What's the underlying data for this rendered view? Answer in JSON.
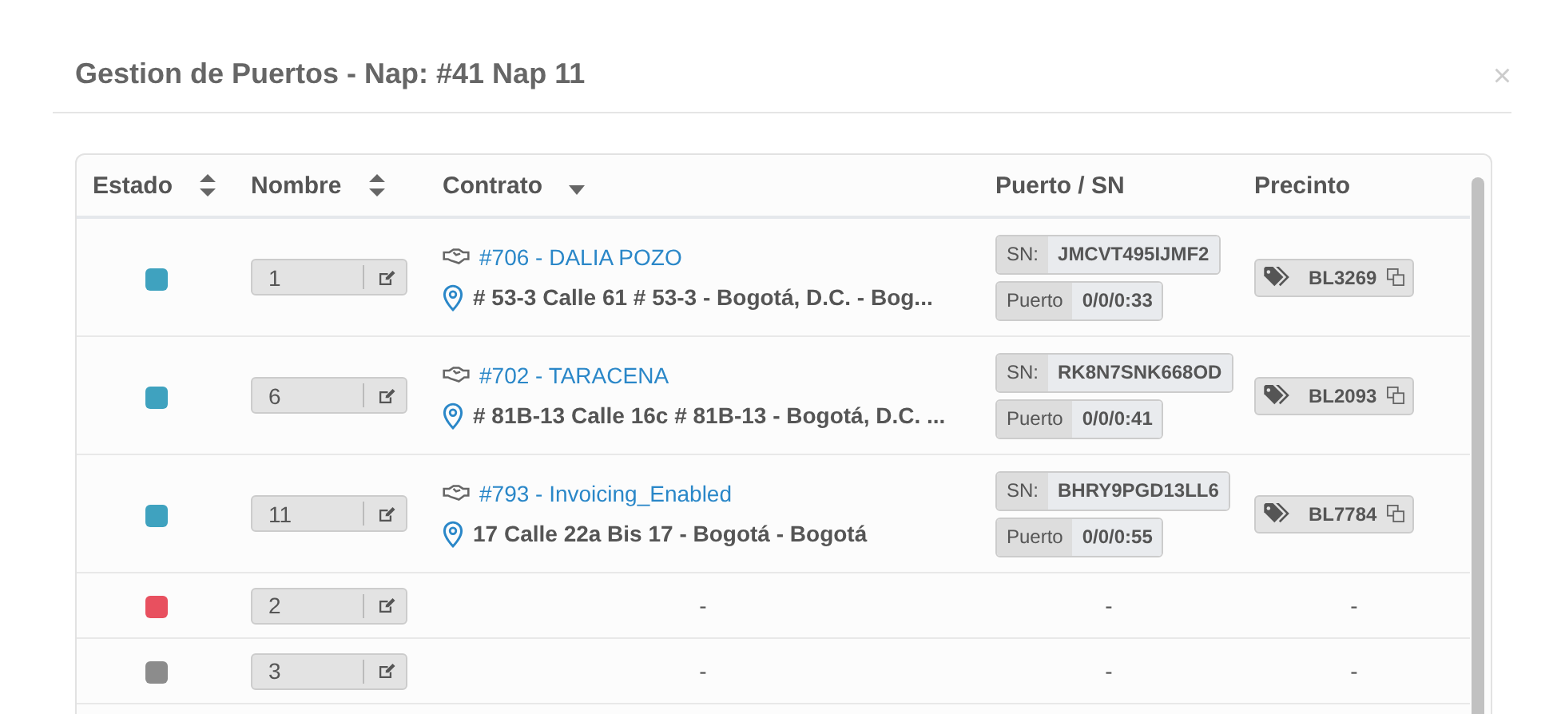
{
  "modal": {
    "title": "Gestion de Puertos - Nap: #41 Nap 11",
    "close": "×"
  },
  "table": {
    "columns": [
      {
        "label": "Estado",
        "sortable": true,
        "sorted": false
      },
      {
        "label": "Nombre",
        "sortable": true,
        "sorted": false
      },
      {
        "label": "Contrato",
        "sortable": true,
        "sorted": true
      },
      {
        "label": "Puerto / SN",
        "sortable": false
      },
      {
        "label": "Precinto",
        "sortable": false
      }
    ],
    "rows": [
      {
        "kind": "assigned",
        "color": "#3fa2bf",
        "name": "1",
        "contract": "#706 - DALIA POZO",
        "address": "# 53-3 Calle 61 # 53-3 - Bogotá, D.C. - Bog...",
        "sn_label": "SN:",
        "sn": "JMCVT495IJMF2",
        "port_label": "Puerto",
        "port": "0/0/0:33",
        "seal": "BL3269"
      },
      {
        "kind": "assigned",
        "color": "#3fa2bf",
        "name": "6",
        "contract": "#702 - TARACENA",
        "address": "# 81B-13 Calle 16c # 81B-13 - Bogotá, D.C. ...",
        "sn_label": "SN:",
        "sn": "RK8N7SNK668OD",
        "port_label": "Puerto",
        "port": "0/0/0:41",
        "seal": "BL2093"
      },
      {
        "kind": "assigned",
        "color": "#3fa2bf",
        "name": "11",
        "contract": "#793 - Invoicing_Enabled",
        "address": "17 Calle 22a Bis 17 - Bogotá - Bogotá",
        "sn_label": "SN:",
        "sn": "BHRY9PGD13LL6",
        "port_label": "Puerto",
        "port": "0/0/0:55",
        "seal": "BL7784"
      },
      {
        "kind": "empty",
        "color": "#e8505f",
        "name": "2",
        "contract": "-",
        "port": "-",
        "seal": "-"
      },
      {
        "kind": "empty",
        "color": "#8c8c8c",
        "name": "3",
        "contract": "-",
        "port": "-",
        "seal": "-"
      }
    ]
  }
}
